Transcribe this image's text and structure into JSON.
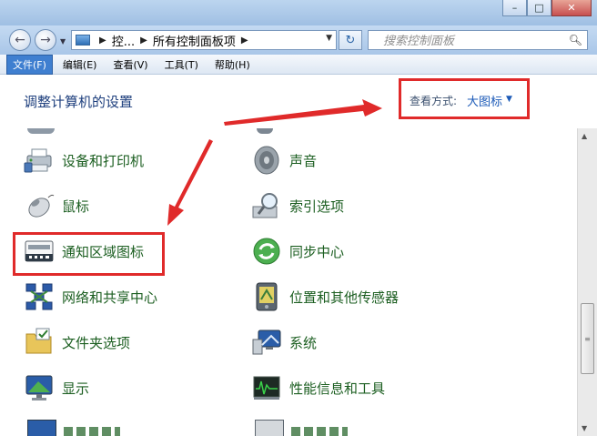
{
  "window": {
    "controls": [
      "minimize",
      "maximize",
      "close"
    ]
  },
  "address_bar": {
    "crumbs": [
      "控...",
      "所有控制面板项"
    ],
    "icon": "control-panel-icon"
  },
  "search": {
    "placeholder": "搜索控制面板",
    "icon": "search-icon"
  },
  "menu": {
    "items": [
      {
        "label": "文件(F)",
        "active": true
      },
      {
        "label": "编辑(E)",
        "active": false
      },
      {
        "label": "查看(V)",
        "active": false
      },
      {
        "label": "工具(T)",
        "active": false
      },
      {
        "label": "帮助(H)",
        "active": false
      }
    ]
  },
  "header": {
    "title": "调整计算机的设置",
    "view_by_label": "查看方式:",
    "view_by_value": "大图标"
  },
  "items": {
    "left": [
      {
        "label": "设备和打印机",
        "icon": "printer-icon"
      },
      {
        "label": "鼠标",
        "icon": "mouse-icon"
      },
      {
        "label": "通知区域图标",
        "icon": "notification-area-icon"
      },
      {
        "label": "网络和共享中心",
        "icon": "network-icon"
      },
      {
        "label": "文件夹选项",
        "icon": "folder-options-icon"
      },
      {
        "label": "显示",
        "icon": "display-icon"
      }
    ],
    "right": [
      {
        "label": "声音",
        "icon": "speaker-icon"
      },
      {
        "label": "索引选项",
        "icon": "index-options-icon"
      },
      {
        "label": "同步中心",
        "icon": "sync-center-icon"
      },
      {
        "label": "位置和其他传感器",
        "icon": "location-sensors-icon"
      },
      {
        "label": "系统",
        "icon": "system-icon"
      },
      {
        "label": "性能信息和工具",
        "icon": "performance-icon"
      }
    ]
  },
  "annotation_color": "#e02a2a"
}
